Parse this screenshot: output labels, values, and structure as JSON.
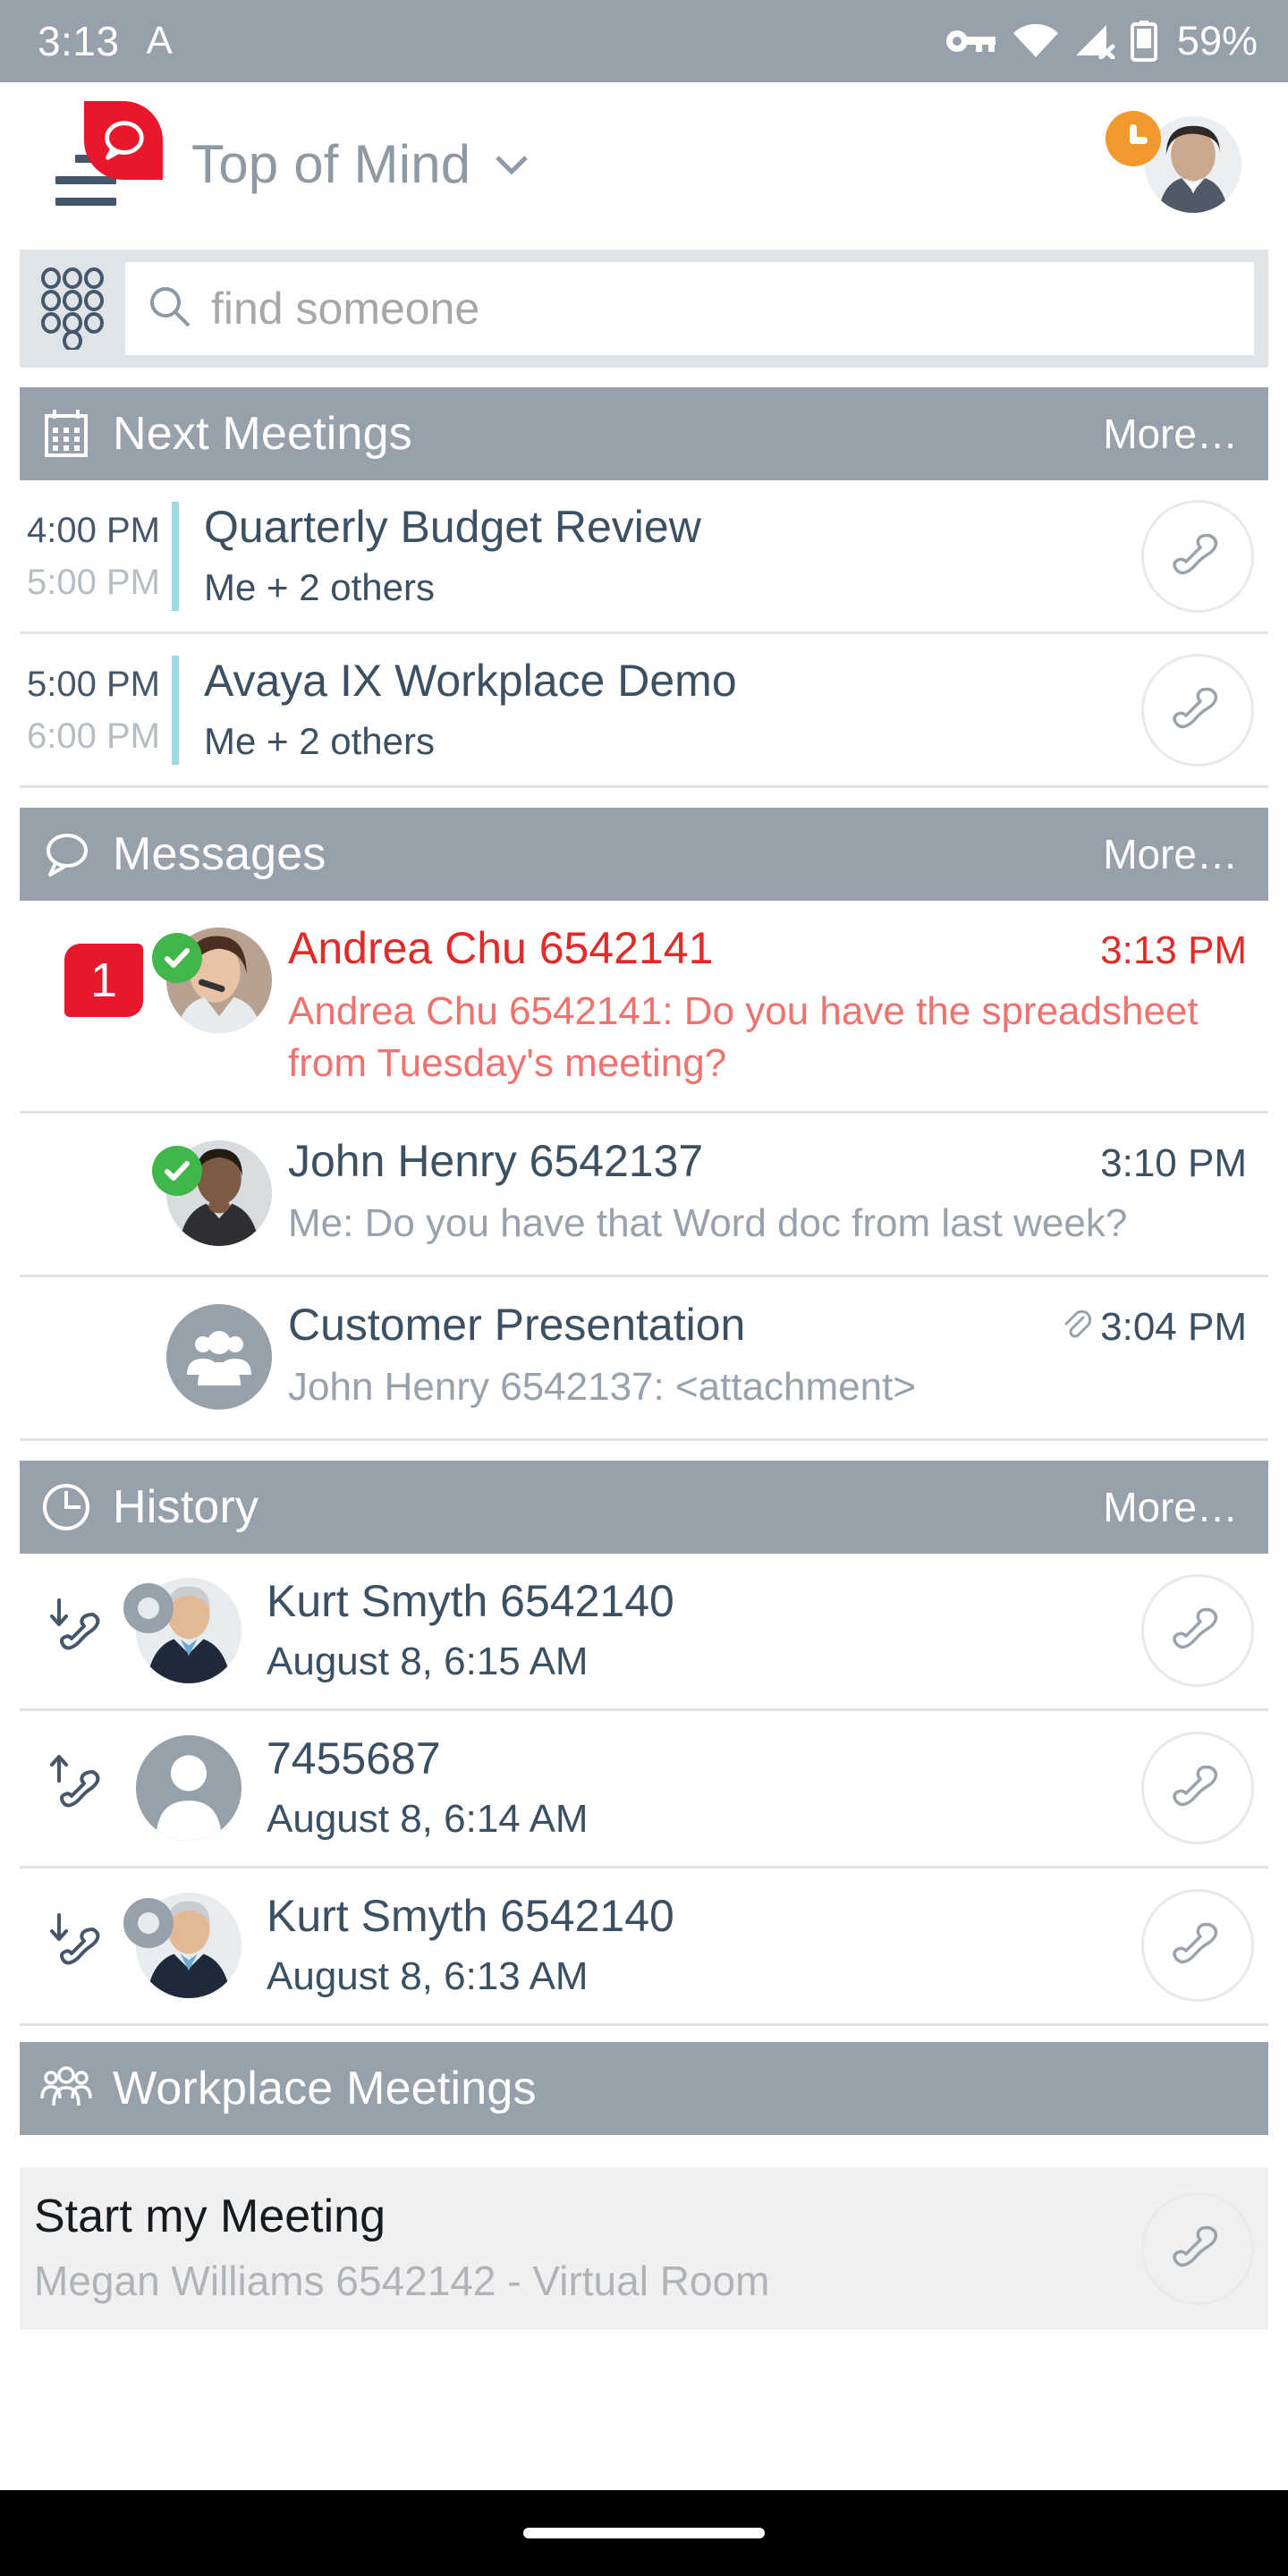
{
  "status_bar": {
    "time": "3:13",
    "alpha_icon": "A",
    "vpn_icon": "vpn-key-icon",
    "wifi_icon": "wifi-icon",
    "cellular_icon": "cellular-no-service-icon",
    "battery_icon": "battery-icon",
    "battery_text": "59%",
    "bg_color": "#97a1ab"
  },
  "app_bar": {
    "menu_icon": "hamburger-menu-icon",
    "app_badge_icon": "avaya-message-badge-icon",
    "badge_color": "#e8172b",
    "title": "Top of Mind",
    "dropdown_icon": "chevron-down-icon",
    "presence": "away",
    "presence_color": "#f2992e",
    "avatar_icon": "user-avatar"
  },
  "search": {
    "dialpad_icon": "dialpad-icon",
    "search_icon": "search-icon",
    "placeholder": "find someone",
    "value": ""
  },
  "sections": [
    {
      "id": "next-meetings",
      "icon": "calendar-icon",
      "title": "Next Meetings",
      "more_label": "More…"
    },
    {
      "id": "messages",
      "icon": "chat-bubble-icon",
      "title": "Messages",
      "more_label": "More…"
    },
    {
      "id": "history",
      "icon": "clock-icon",
      "title": "History",
      "more_label": "More…"
    },
    {
      "id": "workplace-meetings",
      "icon": "people-group-icon",
      "title": "Workplace Meetings",
      "more_label": ""
    }
  ],
  "meetings": [
    {
      "start_time": "4:00 PM",
      "end_time": "5:00 PM",
      "title": "Quarterly Budget Review",
      "participants": "Me + 2 others",
      "accent_color": "#9fd8e0",
      "call_icon": "phone-handset-icon"
    },
    {
      "start_time": "5:00 PM",
      "end_time": "6:00 PM",
      "title": "Avaya IX Workplace Demo",
      "participants": "Me + 2 others",
      "accent_color": "#9fd8e0",
      "call_icon": "phone-handset-icon"
    }
  ],
  "messages": [
    {
      "unread_count": "1",
      "presence": "available",
      "avatar": "andrea-chu-avatar",
      "name": "Andrea Chu 6542141",
      "time": "3:13 PM",
      "preview": "Andrea Chu 6542141: Do you have the spreadsheet from Tuesday's meeting?",
      "unread": true,
      "has_attachment": false,
      "name_color": "#e02b28",
      "preview_color": "#f0726f"
    },
    {
      "unread_count": "",
      "presence": "available",
      "avatar": "john-henry-avatar",
      "name": "John Henry 6542137",
      "time": "3:10 PM",
      "preview": "Me: Do you have that Word doc from last week?",
      "unread": false,
      "has_attachment": false,
      "name_color": "#3c5064",
      "preview_color": "#98a2ac"
    },
    {
      "unread_count": "",
      "presence": "none",
      "avatar": "group-avatar",
      "name": "Customer Presentation",
      "time": "3:04 PM",
      "preview": "John Henry 6542137:  <attachment>",
      "unread": false,
      "has_attachment": true,
      "attachment_icon": "paperclip-icon",
      "name_color": "#3c5064",
      "preview_color": "#98a2ac"
    }
  ],
  "history": [
    {
      "direction": "incoming",
      "direction_icon": "incoming-call-icon",
      "presence": "offline",
      "avatar": "kurt-smyth-avatar",
      "name": "Kurt Smyth 6542140",
      "timestamp": "August 8, 6:15 AM",
      "call_icon": "phone-handset-icon"
    },
    {
      "direction": "outgoing",
      "direction_icon": "outgoing-call-icon",
      "presence": "none",
      "avatar": "generic-person-avatar",
      "name": "7455687",
      "timestamp": "August 8, 6:14 AM",
      "call_icon": "phone-handset-icon"
    },
    {
      "direction": "incoming",
      "direction_icon": "incoming-call-icon",
      "presence": "offline",
      "avatar": "kurt-smyth-avatar",
      "name": "Kurt Smyth 6542140",
      "timestamp": "August 8, 6:13 AM",
      "call_icon": "phone-handset-icon"
    }
  ],
  "start_my_meeting": {
    "title": "Start my Meeting",
    "subtitle": "Megan Williams 6542142 - Virtual Room",
    "call_icon": "phone-handset-icon"
  },
  "nav_bar": {
    "home_pill": "home-indicator"
  }
}
